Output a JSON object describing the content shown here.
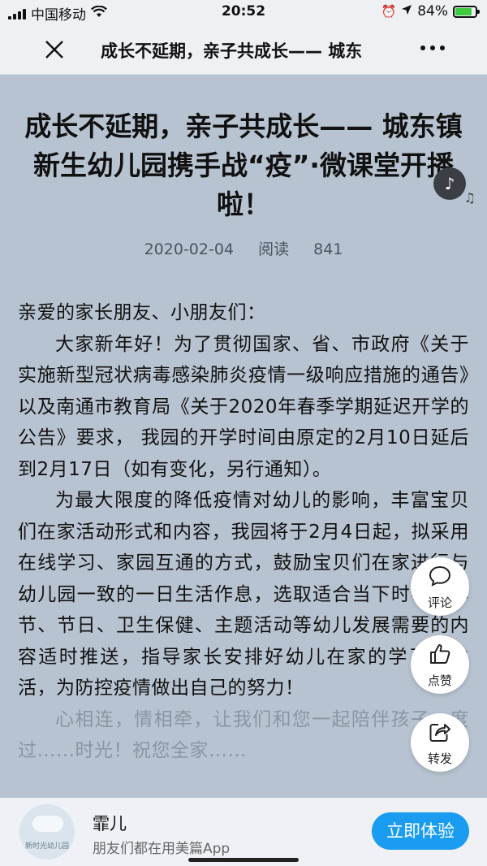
{
  "status_bar": {
    "carrier": "中国移动",
    "time": "20:52",
    "battery_percent": "84%",
    "battery_level": 0.84,
    "icons": [
      "signal-icon",
      "wifi-icon",
      "alarm-icon",
      "location-icon",
      "battery-icon"
    ]
  },
  "nav": {
    "close_label": "✕",
    "title": "成长不延期，亲子共成长—— 城东",
    "more_label": "more"
  },
  "article": {
    "title": "成长不延期，亲子共成长—— 城东镇新生幼儿园携手战“疫”·微课堂开播啦！",
    "date": "2020-02-04",
    "reads_label": "阅读",
    "reads_count": "841",
    "greeting": "亲爱的家长朋友、小朋友们：",
    "paragraph_1": "大家新年好！为了贯彻国家、省、市政府《关于实施新型冠状病毒感染肺炎疫情一级响应措施的通告》以及南通市教育局《关于2020年春季学期延迟开学的公告》要求， 我园的开学时间由原定的2月10日延后到2月17日（如有变化，另行通知）。",
    "paragraph_2": "为最大限度的降低疫情对幼儿的影响，丰富宝贝们在家活动形式和内容，我园将于2月4日起，拟采用在线学习、家园互通的方式，鼓励宝贝们在家进行与幼儿园一致的一日生活作息，选取适合当下时事、季节、节日、卫生保健、主题活动等幼儿发展需要的内容适时推送，指导家长安排好幼儿在家的学习和生活，为防控疫情做出自己的努力！",
    "paragraph_3": "心相连，情相牵，让我们和您一起陪伴孩子，度过……时光！祝您全家……"
  },
  "actions": {
    "comment_label": "评论",
    "like_label": "点赞",
    "share_label": "转发"
  },
  "promo": {
    "avatar_caption": "新时光幼儿园",
    "name": "霏儿",
    "subtitle": "朋友们都在用美篇App",
    "button_label": "立即体验"
  },
  "colors": {
    "background": "#b7c3d0",
    "accent": "#1a9cf0"
  }
}
